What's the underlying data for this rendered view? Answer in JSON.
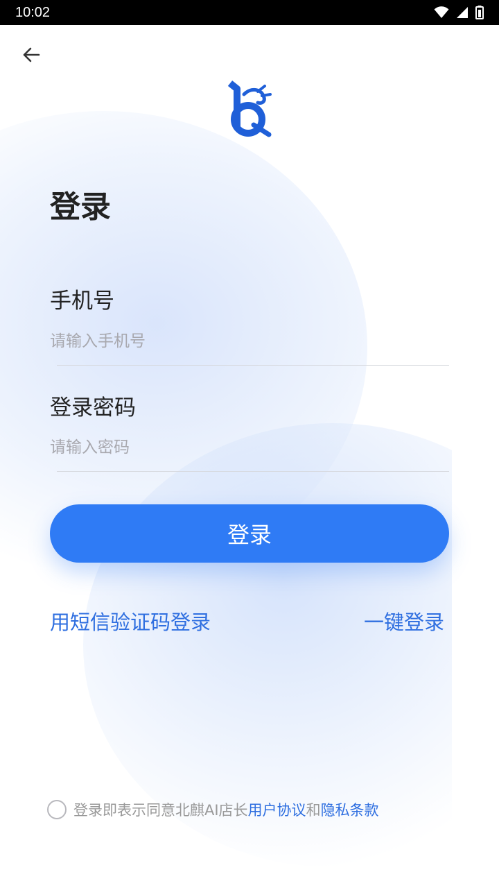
{
  "status_bar": {
    "time": "10:02",
    "icons": [
      "wifi-icon",
      "cellular-signal-icon",
      "battery-icon"
    ]
  },
  "header": {
    "back_icon": "arrow-left-icon",
    "logo": "app-logo"
  },
  "page": {
    "title": "登录"
  },
  "form": {
    "phone": {
      "label": "手机号",
      "placeholder": "请输入手机号",
      "value": ""
    },
    "password": {
      "label": "登录密码",
      "placeholder": "请输入密码",
      "value": ""
    },
    "submit_label": "登录"
  },
  "alt_login": {
    "sms_label": "用短信验证码登录",
    "one_key_label": "一键登录"
  },
  "agreement": {
    "checked": false,
    "prefix": "登录即表示同意北麒AI店长",
    "user_agreement": "用户协议",
    "and": "和",
    "privacy_terms": "隐私条款"
  },
  "colors": {
    "primary": "#2f7bf5",
    "link": "#2f6fe0",
    "title": "#222222",
    "placeholder": "#a8a8ae",
    "muted": "#999999"
  }
}
